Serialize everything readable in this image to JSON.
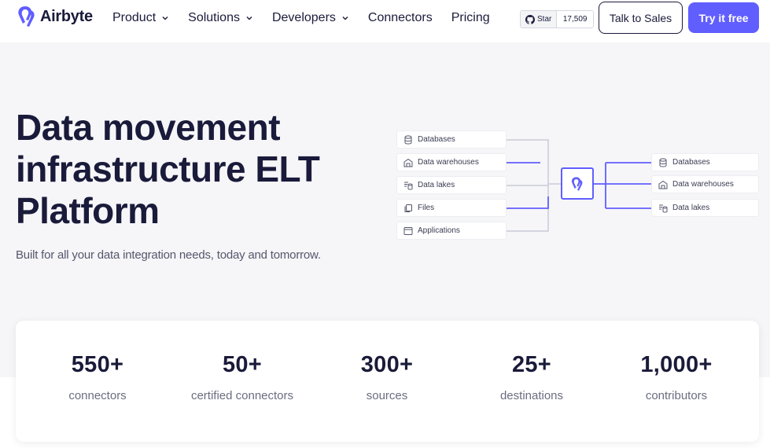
{
  "nav": {
    "brand": "Airbyte",
    "links": [
      {
        "label": "Product",
        "has_dropdown": true
      },
      {
        "label": "Solutions",
        "has_dropdown": true
      },
      {
        "label": "Developers",
        "has_dropdown": true
      },
      {
        "label": "Connectors",
        "has_dropdown": false
      },
      {
        "label": "Pricing",
        "has_dropdown": false
      }
    ],
    "github": {
      "label": "Star",
      "count": "17,509",
      "icon": "github-icon"
    },
    "talk_to_sales": "Talk to Sales",
    "try_free": "Try it free"
  },
  "hero": {
    "title_lines": [
      "Data movement",
      "infrastructure ELT",
      "Platform"
    ],
    "subtitle": "Built for all your data integration needs, today and tomorrow."
  },
  "diagram": {
    "sources": [
      {
        "label": "Databases",
        "icon": "database-icon"
      },
      {
        "label": "Data warehouses",
        "icon": "warehouse-icon"
      },
      {
        "label": "Data lakes",
        "icon": "data-lake-icon"
      },
      {
        "label": "Files",
        "icon": "files-icon"
      },
      {
        "label": "Applications",
        "icon": "application-icon"
      }
    ],
    "destinations": [
      {
        "label": "Databases",
        "icon": "database-icon"
      },
      {
        "label": "Data warehouses",
        "icon": "warehouse-icon"
      },
      {
        "label": "Data lakes",
        "icon": "data-lake-icon"
      }
    ],
    "hub_icon": "airbyte-logo-icon"
  },
  "stats": [
    {
      "value": "550+",
      "label": "connectors"
    },
    {
      "value": "50+",
      "label": "certified connectors"
    },
    {
      "value": "300+",
      "label": "sources"
    },
    {
      "value": "25+",
      "label": "destinations"
    },
    {
      "value": "1,000+",
      "label": "contributors"
    }
  ],
  "colors": {
    "accent": "#615eff",
    "text_dark": "#1a1b3a",
    "page_bg": "#f6f6f9",
    "line_gray": "#c9cad6"
  }
}
